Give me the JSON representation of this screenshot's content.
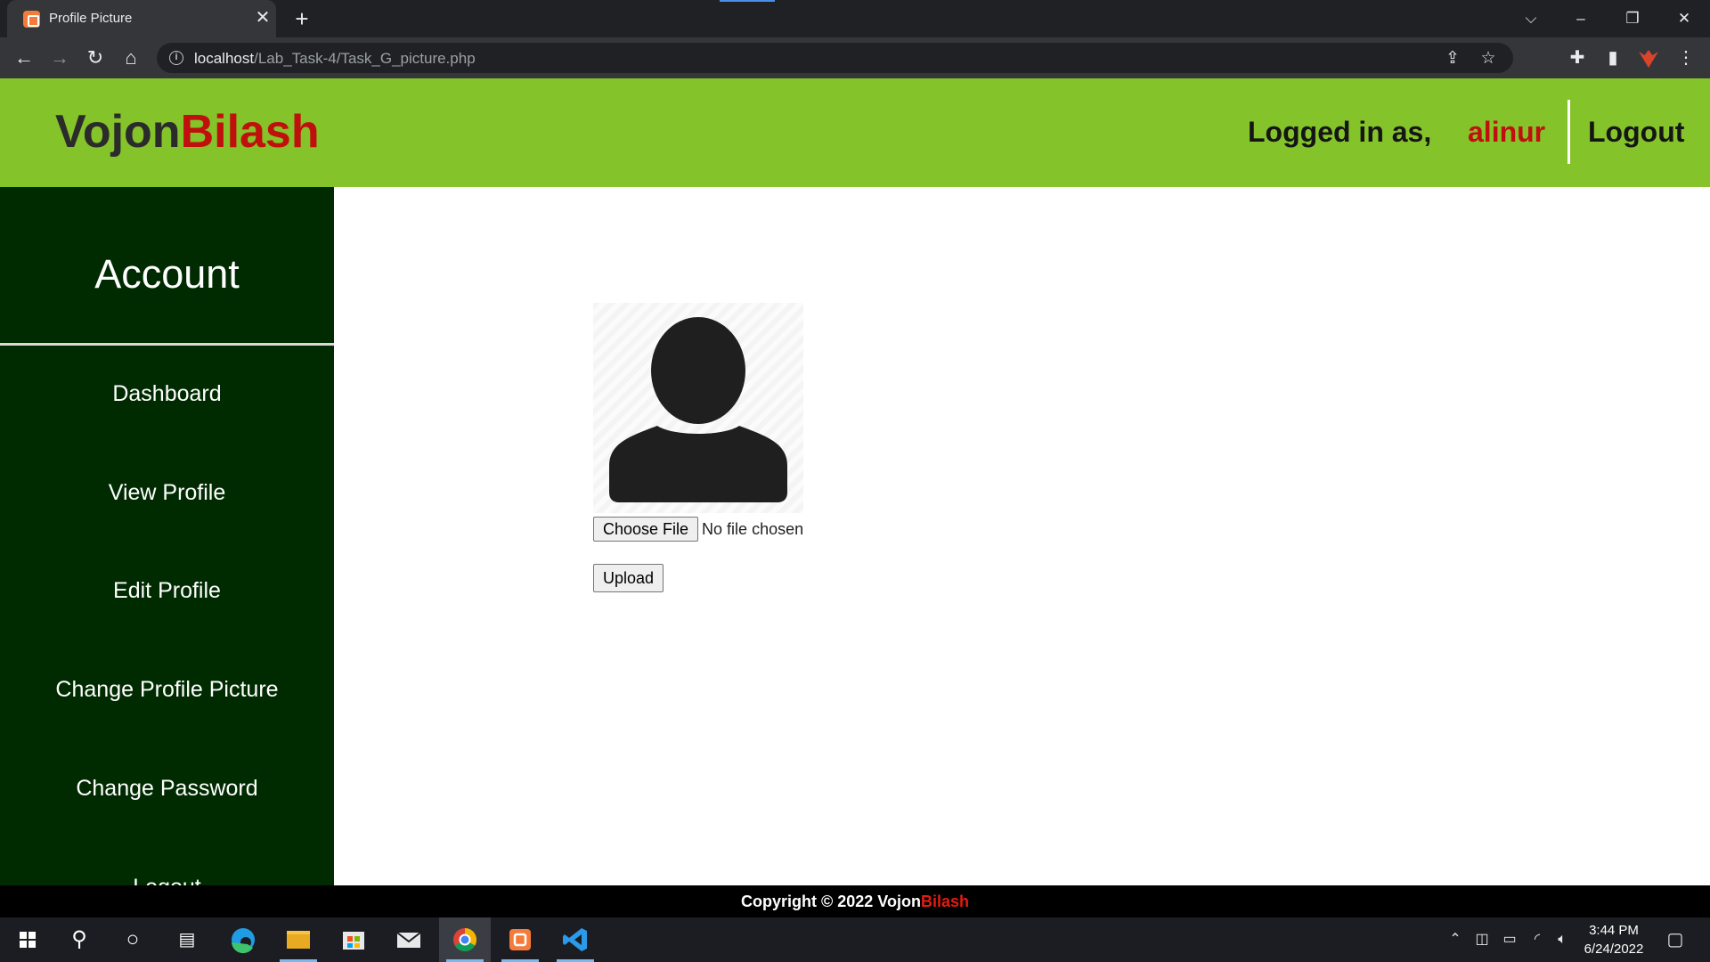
{
  "browser": {
    "tab_title": "Profile Picture",
    "tab_close": "✕",
    "new_tab": "+",
    "url_host": "localhost",
    "url_path": "/Lab_Task-4/Task_G_picture.php"
  },
  "header": {
    "logo_part1": "Vojon",
    "logo_part2": "Bilash",
    "logged_in_label": "Logged in as,",
    "username": "alinur",
    "logout": "Logout"
  },
  "sidebar": {
    "title": "Account",
    "items": [
      {
        "label": "Dashboard"
      },
      {
        "label": "View Profile"
      },
      {
        "label": "Edit Profile"
      },
      {
        "label": "Change Profile Picture"
      },
      {
        "label": "Change Password"
      },
      {
        "label": "Logout"
      }
    ]
  },
  "upload": {
    "choose_file_label": "Choose File",
    "no_file_text": "No file chosen",
    "upload_label": "Upload"
  },
  "footer": {
    "prefix": "Copyright © 2022 Vojon",
    "brand_part2": "Bilash"
  },
  "taskbar": {
    "time": "3:44 PM",
    "date": "6/24/2022"
  },
  "colors": {
    "header_bg": "#84c329",
    "sidebar_bg": "#002b01",
    "brand_red": "#c0100d",
    "footer_bg": "#000000"
  }
}
